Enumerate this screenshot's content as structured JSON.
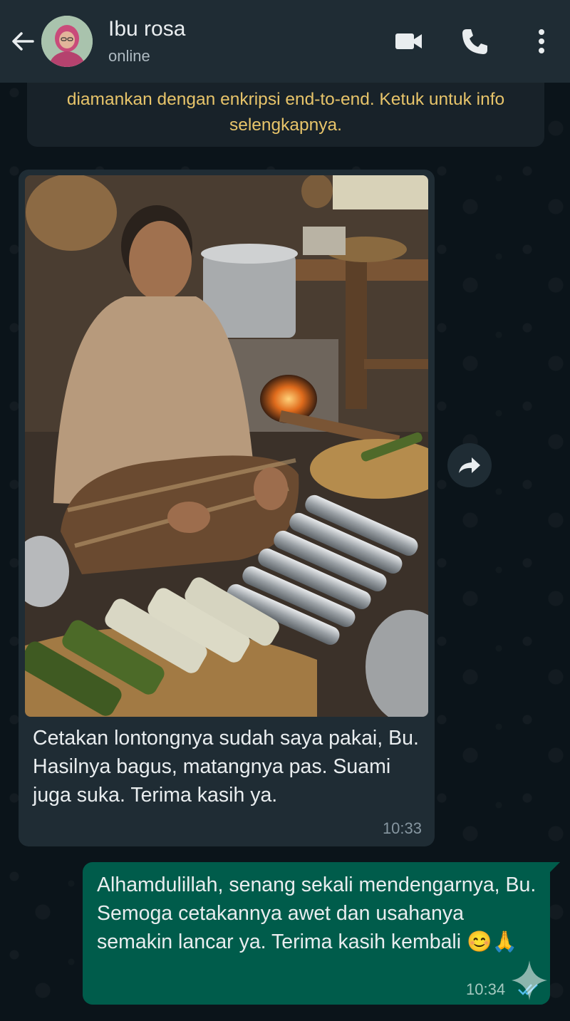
{
  "header": {
    "contact_name": "Ibu rosa",
    "status": "online",
    "icons": [
      "back-arrow-icon",
      "video-call-icon",
      "phone-icon",
      "more-options-icon"
    ]
  },
  "notice": {
    "text": "diamankan dengan enkripsi end-to-end. Ketuk untuk info selengkapnya."
  },
  "messages": [
    {
      "direction": "incoming",
      "has_photo": true,
      "text": "Cetakan lontongnya sudah saya pakai, Bu. Hasilnya bagus, matangnya pas. Suami juga suka. Terima kasih ya.",
      "time": "10:33"
    },
    {
      "direction": "outgoing",
      "text": "Alhamdulillah, senang sekali mendengarnya, Bu. Semoga cetakannya awet dan usahanya semakin lancar ya. Terima kasih kembali 😊🙏",
      "time": "10:34",
      "status_icon": "double-check-icon"
    }
  ],
  "colors": {
    "header_bg": "#1f2c34",
    "chat_bg": "#0b141a",
    "incoming_bubble": "#1f2c34",
    "outgoing_bubble": "#005c4b",
    "notice_text": "#e7c46a",
    "read_ticks": "#53bdeb"
  }
}
